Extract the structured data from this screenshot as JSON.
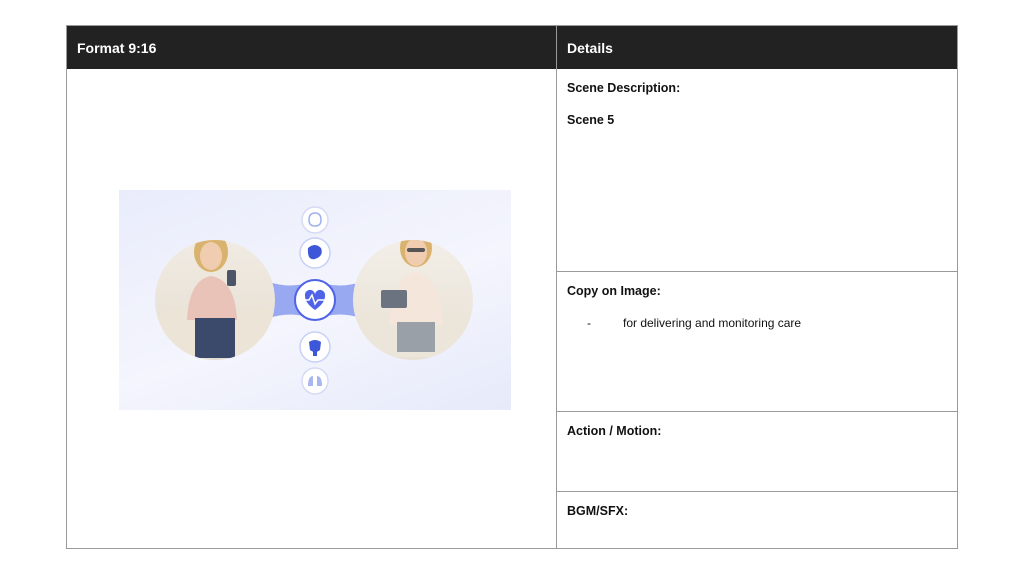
{
  "header": {
    "left_title": "Format 9:16",
    "right_title": "Details"
  },
  "scene": {
    "label": "Scene Description:",
    "value": "Scene 5"
  },
  "copy": {
    "label": "Copy on Image:",
    "bullet": "-",
    "text": "for delivering and monitoring care"
  },
  "action": {
    "label": "Action / Motion:"
  },
  "bgm": {
    "label": "BGM/SFX:"
  },
  "colors": {
    "header_bg": "#222222",
    "accent_blue": "#4f63e8",
    "connector": "#8ea0f0"
  },
  "icons": [
    "brain-icon",
    "stomach-icon",
    "heart-pulse-icon",
    "bladder-icon",
    "lungs-icon"
  ]
}
